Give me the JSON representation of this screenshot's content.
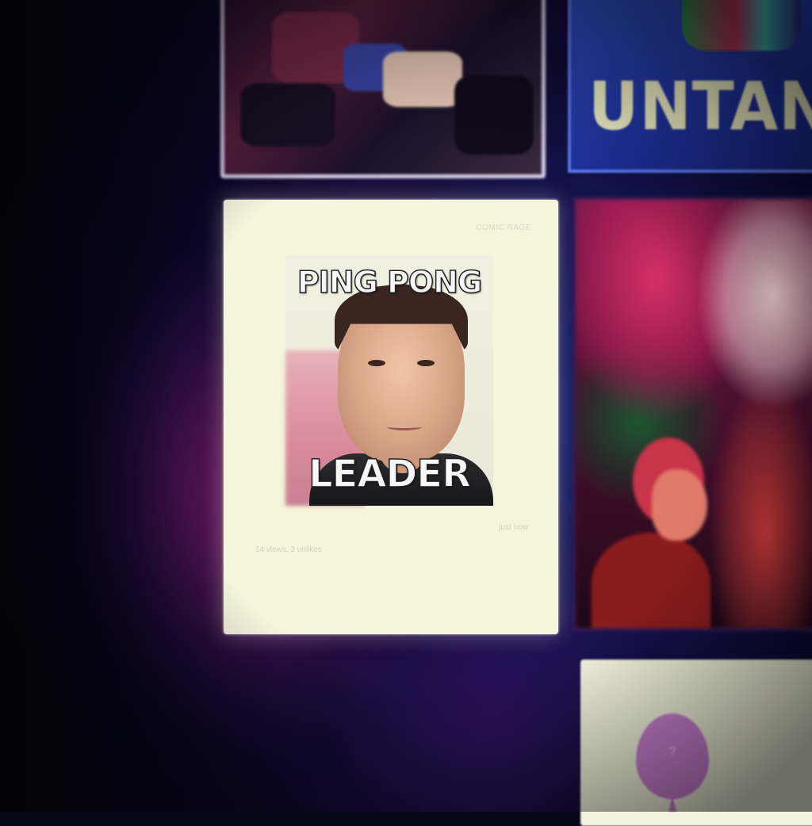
{
  "banner": {
    "text": "UNTANGI"
  },
  "card": {
    "tag": "COMIC RAGE",
    "meme_top": "PING PONG",
    "meme_bottom": "LEADER",
    "time": "just now",
    "stats": "14 views, 3 unlikes"
  },
  "bottom_card": {
    "balloon_label": "?"
  },
  "colors": {
    "background": "#07051a",
    "card": "#f4f6dc",
    "banner_blue": "#1e2f9a",
    "banner_text": "#f2f1c6",
    "balloon": "#c97fd0"
  }
}
